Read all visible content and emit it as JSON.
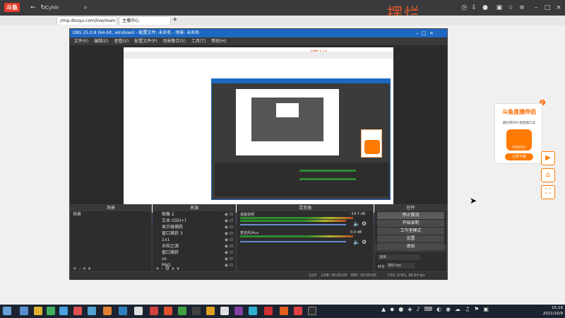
{
  "browser": {
    "brand": "斗鱼",
    "top_title": "Cyhit-",
    "tabs": [
      {
        "label": "//mp.douyu.com/live/main"
      },
      {
        "label": "主播中心"
      }
    ],
    "overlay_text": "摆烂"
  },
  "obs": {
    "title": "OBS 25.0.8 (64-bit, windows) - 配置文件: 未命名 - 场景: 未命名",
    "menu": [
      "文件(F)",
      "编辑(E)",
      "查看(V)",
      "配置文件(P)",
      "场景集合(S)",
      "工具(T)",
      "帮助(H)"
    ],
    "preview_overlay_text": "摆烂",
    "panels": {
      "scenes": {
        "title": "场景",
        "items": [
          "场景"
        ]
      },
      "sources": {
        "title": "来源",
        "items": [
          "图像 2",
          "文本 (GDI+)",
          "显示器捕获",
          "窗口捕获 3",
          "1x1",
          "未知之源",
          "窗口捕获",
          "xx",
          "PNG",
          "ssd"
        ]
      },
      "mixer": {
        "title": "混音器",
        "channels": [
          {
            "name": "桌面音频",
            "db": "-14.7 dB"
          },
          {
            "name": "麦克风/Aux",
            "db": "0.0 dB"
          }
        ]
      },
      "transitions": {
        "title": "转场特效",
        "type": "淡出",
        "duration_label": "时长",
        "duration": "300 ms"
      },
      "controls": {
        "title": "控件",
        "buttons": [
          "停止推流",
          "开始录制",
          "工作室模式",
          "设置",
          "退出"
        ]
      }
    },
    "status": {
      "live": "LIVE: 00:00:00",
      "rec": "REC: 00:00:00",
      "cpu": "CPU: 0.9%, 60.00 fps",
      "frames": "12/0"
    }
  },
  "promo": {
    "title": "斗鱼直播伴侣",
    "subtitle": "最好用的PC端直播工具",
    "logo_text": "DOUYU",
    "button": "立即下载",
    "close": "×"
  },
  "taskbar": {
    "time": "15:19",
    "date": "2021/10/9"
  }
}
